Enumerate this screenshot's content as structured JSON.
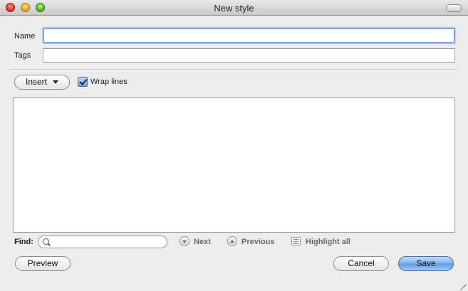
{
  "window": {
    "title": "New style"
  },
  "form": {
    "name_label": "Name",
    "name_value": "",
    "tags_label": "Tags",
    "tags_value": ""
  },
  "toolbar": {
    "insert_label": "Insert",
    "wrap_lines_label": "Wrap lines",
    "wrap_lines_checked": true
  },
  "editor": {
    "content": ""
  },
  "find": {
    "label": "Find:",
    "value": "",
    "next_label": "Next",
    "previous_label": "Previous",
    "highlight_all_label": "Highlight all"
  },
  "buttons": {
    "preview": "Preview",
    "cancel": "Cancel",
    "save": "Save"
  },
  "colors": {
    "focus_ring": "#7fa7de",
    "primary_button": "#6aa6ea"
  }
}
